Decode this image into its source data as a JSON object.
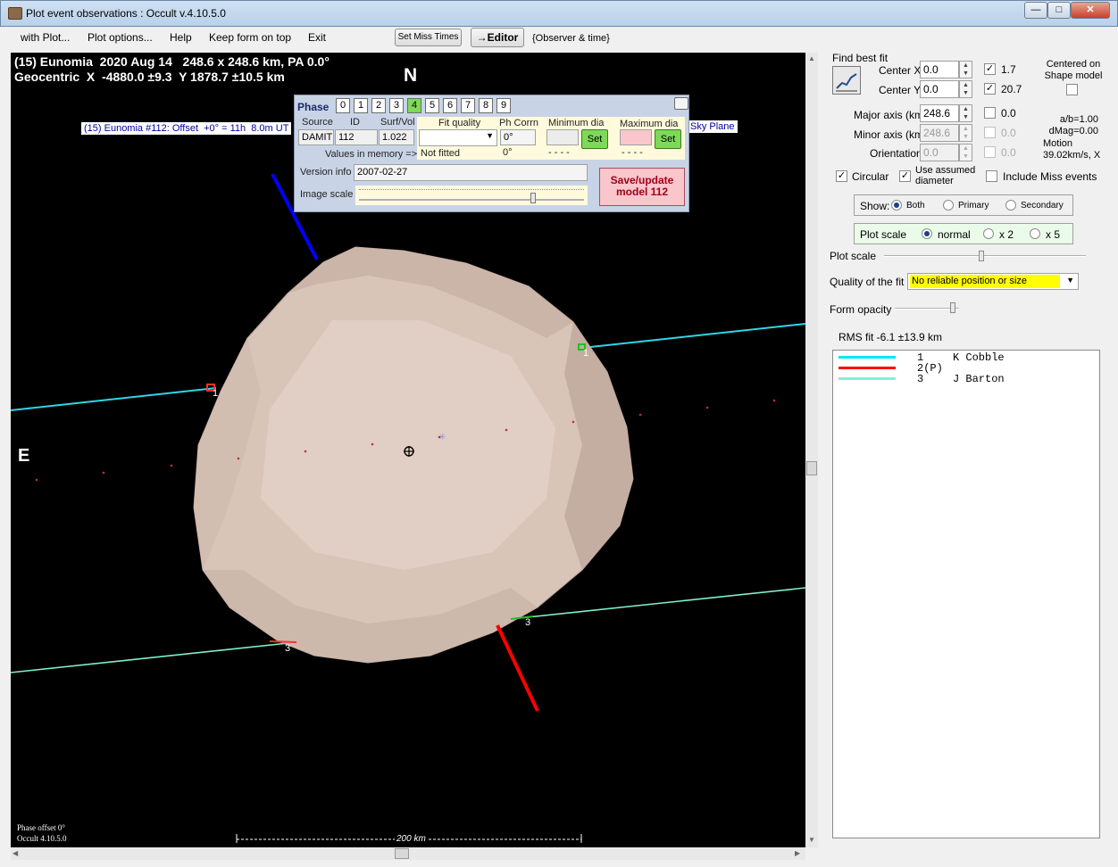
{
  "window": {
    "title": "Plot event observations : Occult v.4.10.5.0",
    "minimize": "—",
    "maximize": "□",
    "close": "✕"
  },
  "menu": {
    "items": [
      "with Plot...",
      "Plot options...",
      "Help",
      "Keep form on top",
      "Exit"
    ],
    "set_miss_times": "Set Miss Times",
    "editor": "→Editor",
    "observer_time": "{Observer & time}"
  },
  "plot": {
    "header_line1": "(15) Eunomia  2020 Aug 14   248.6 x 248.6 km, PA 0.0°",
    "header_line2": "Geocentric  X  -4880.0 ±9.3  Y 1878.7 ±10.5 km",
    "north": "N",
    "east": "E",
    "offset_label": "(15) Eunomia #112: Offset  +0° = 11h  8.0m UT",
    "sky_plane": "Sky Plane",
    "chord_labels": [
      "1",
      "1",
      "3",
      "3"
    ],
    "footer_line1": "Phase offset 0°",
    "footer_line2": "Occult 4.10.5.0",
    "scale_label": "200 km",
    "colors": {
      "chord1": "#2fd6e6",
      "chord3": "#7ff0cc",
      "north_arrow": "#0000ff",
      "motion_arrow": "#ff0000",
      "body": "#d9c4b8"
    }
  },
  "phase_panel": {
    "title": "Phase",
    "phases": [
      "0",
      "1",
      "2",
      "3",
      "4",
      "5",
      "6",
      "7",
      "8",
      "9"
    ],
    "active_phase": "4",
    "source_label": "Source",
    "id_label": "ID",
    "surfvol_label": "Surf/Vol",
    "source": "DAMIT",
    "id": "112",
    "surfvol": "1.022",
    "fit_quality_label": "Fit quality",
    "ph_corrn_label": "Ph Corrn",
    "min_dia_label": "Minimum dia",
    "max_dia_label": "Maximum dia",
    "ph_corrn": "0°",
    "set": "Set",
    "values_in_memory": "Values in memory =>",
    "not_fitted": "Not fitted",
    "mem_ph": "0°",
    "mem_min": "- - - -",
    "mem_max": "- - - -",
    "version_label": "Version info",
    "version": "2007-02-27",
    "image_scale_label": "Image scale",
    "save_label": "Save/update model 112"
  },
  "right_panel": {
    "find_best_fit": "Find best fit",
    "center_x_label": "Center X",
    "center_x": "0.0",
    "center_y_label": "Center Y",
    "center_y": "0.0",
    "cx_check_value": "1.7",
    "cy_check_value": "20.7",
    "centered_on": "Centered on Shape model",
    "major_label": "Major axis (km)",
    "major": "248.6",
    "major_check_value": "0.0",
    "minor_label": "Minor axis (km)",
    "minor": "248.6",
    "minor_check_value": "0.0",
    "orient_label": "Orientation",
    "orient": "0.0",
    "orient_check_value": "0.0",
    "ab": "a/b=1.00",
    "dmag": "dMag=0.00",
    "motion": "Motion",
    "motion_value": "39.02km/s, X",
    "circular": "Circular",
    "use_assumed": "Use assumed diameter",
    "include_miss": "Include Miss events",
    "show_label": "Show:",
    "show_options": [
      "Both",
      "Primary",
      "Secondary"
    ],
    "plot_scale_group": "Plot scale",
    "scale_options": [
      "normal",
      "x 2",
      "x 5"
    ],
    "plot_scale_slider": "Plot scale",
    "quality_label": "Quality of the fit",
    "quality_value": "No reliable position or size",
    "form_opacity": "Form opacity",
    "rms_fit": "RMS fit -6.1 ±13.9 km",
    "legend": [
      {
        "num": "1",
        "name": "K Cobble",
        "color": "#00e5ff"
      },
      {
        "num": "2(P)",
        "name": "",
        "color": "#ff0000"
      },
      {
        "num": "3",
        "name": "J Barton",
        "color": "#7ff0d8"
      }
    ]
  }
}
